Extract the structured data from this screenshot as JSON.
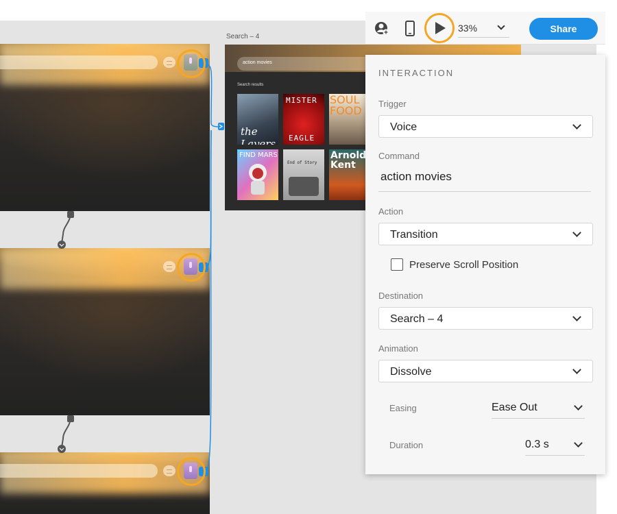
{
  "canvas": {
    "artboard_title": "Search – 4",
    "search_artboard": {
      "search_text": "action movies",
      "results_label": "Search results",
      "posters": [
        {
          "title": "the Layers"
        },
        {
          "title": "MISTER"
        },
        {
          "title": "EAGLE"
        },
        {
          "title": "SOUL FOOD"
        },
        {
          "title": "FIND MARS"
        },
        {
          "title": "End of Story"
        },
        {
          "title": "Arnold Kent"
        }
      ]
    }
  },
  "toolbar": {
    "zoom": "33%",
    "share_label": "Share"
  },
  "panel": {
    "title": "INTERACTION",
    "trigger": {
      "label": "Trigger",
      "value": "Voice"
    },
    "command": {
      "label": "Command",
      "value": "action movies"
    },
    "action": {
      "label": "Action",
      "value": "Transition"
    },
    "preserve_scroll": {
      "label": "Preserve Scroll Position",
      "checked": false
    },
    "destination": {
      "label": "Destination",
      "value": "Search – 4"
    },
    "animation": {
      "label": "Animation",
      "value": "Dissolve"
    },
    "easing": {
      "label": "Easing",
      "value": "Ease Out"
    },
    "duration": {
      "label": "Duration",
      "value": "0.3 s"
    }
  },
  "colors": {
    "accent": "#1f8fe6",
    "highlight_ring": "#f5a623",
    "canvas": "#e4e4e4",
    "panel": "#f6f6f6"
  }
}
